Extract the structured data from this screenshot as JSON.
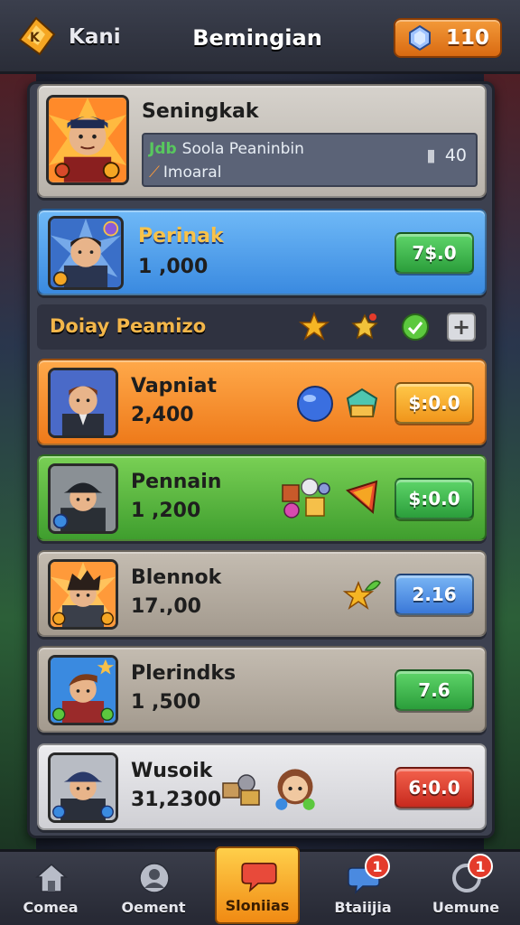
{
  "header": {
    "left_label": "Kani",
    "title": "Bemingian",
    "currency_value": "110"
  },
  "featured": {
    "name": "Seningkak",
    "sub_tag": "Jdb",
    "sub_text": "Soola Peaninbin",
    "sub_line2": "Imoaral",
    "count": "40"
  },
  "cards": [
    {
      "name": "Perinak",
      "score": "1 ,000",
      "price": "7$.0",
      "color": "#4aa3f0",
      "button": "green"
    },
    {
      "name": "Vapniat",
      "score": "2,400",
      "price": "$:0.0",
      "color": "#f28a2b",
      "button": "orange"
    },
    {
      "name": "Pennain",
      "score": "1 ,200",
      "price": "$:0.0",
      "color": "#59b947",
      "button": "green"
    },
    {
      "name": "Blennok",
      "score": "17.,00",
      "price": "2.16",
      "color": "#b0a69a",
      "button": "blue"
    },
    {
      "name": "Plerindks",
      "score": "1 ,500",
      "price": "7.6",
      "color": "#b0a69a",
      "button": "green"
    },
    {
      "name": "Wusoik",
      "score": "31,2300",
      "price": "6:0.0",
      "color": "#e0e0e4",
      "button": "red"
    }
  ],
  "section": {
    "title": "Doiay Peamizo"
  },
  "nav": [
    {
      "label": "Comea",
      "icon": "home-icon"
    },
    {
      "label": "Oement",
      "icon": "profile-icon"
    },
    {
      "label": "Sloniias",
      "icon": "chat-bubble-icon",
      "active": true
    },
    {
      "label": "Btaiijia",
      "icon": "message-icon",
      "badge": "1"
    },
    {
      "label": "Uemune",
      "icon": "refresh-icon",
      "badge": "1"
    }
  ],
  "colors": {
    "accent_orange": "#f08a13",
    "panel": "#3d4150",
    "header": "#2a2d38"
  }
}
